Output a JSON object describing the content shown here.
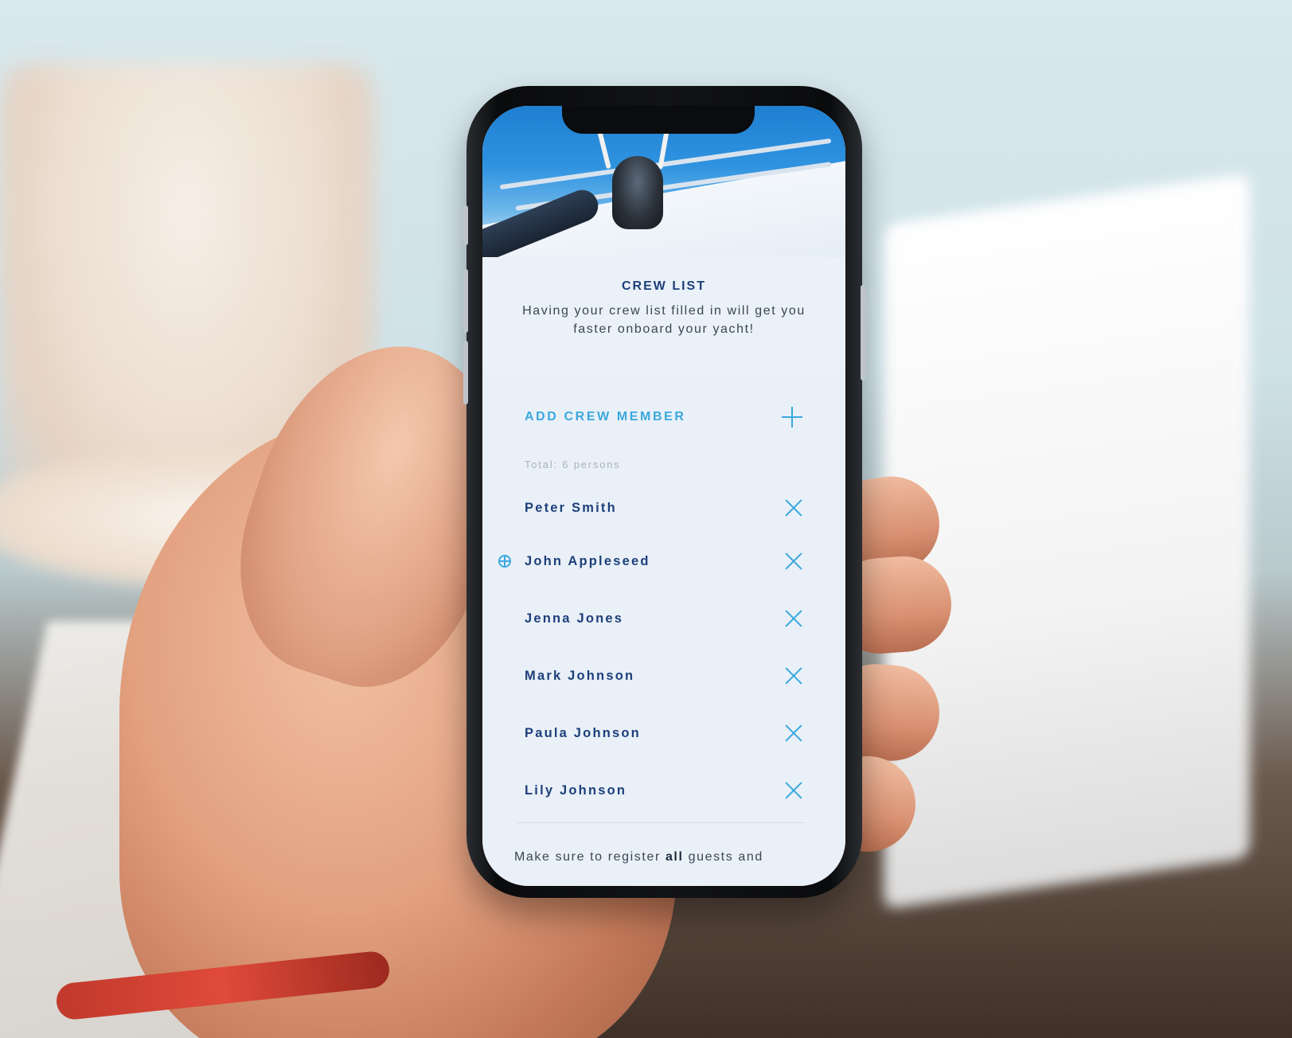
{
  "screen": {
    "title": "CREW LIST",
    "subtitle": "Having your crew list filled in will get you faster onboard your yacht!",
    "add_label": "ADD CREW MEMBER",
    "total": "Total: 6 persons",
    "crew": [
      {
        "name": "Peter Smith",
        "skipper": false
      },
      {
        "name": "John Appleseed",
        "skipper": true
      },
      {
        "name": "Jenna Jones",
        "skipper": false
      },
      {
        "name": "Mark Johnson",
        "skipper": false
      },
      {
        "name": "Paula Johnson",
        "skipper": false
      },
      {
        "name": "Lily Johnson",
        "skipper": false
      }
    ],
    "footer_prefix": "Make sure to register ",
    "footer_bold": "all",
    "footer_suffix": " guests and"
  },
  "colors": {
    "title": "#1d3f7a",
    "accent": "#3aa8de",
    "panel": "#e9f0f7"
  },
  "icons": {
    "add": "plus-icon",
    "remove": "close-icon",
    "skipper": "ship-wheel-icon"
  }
}
